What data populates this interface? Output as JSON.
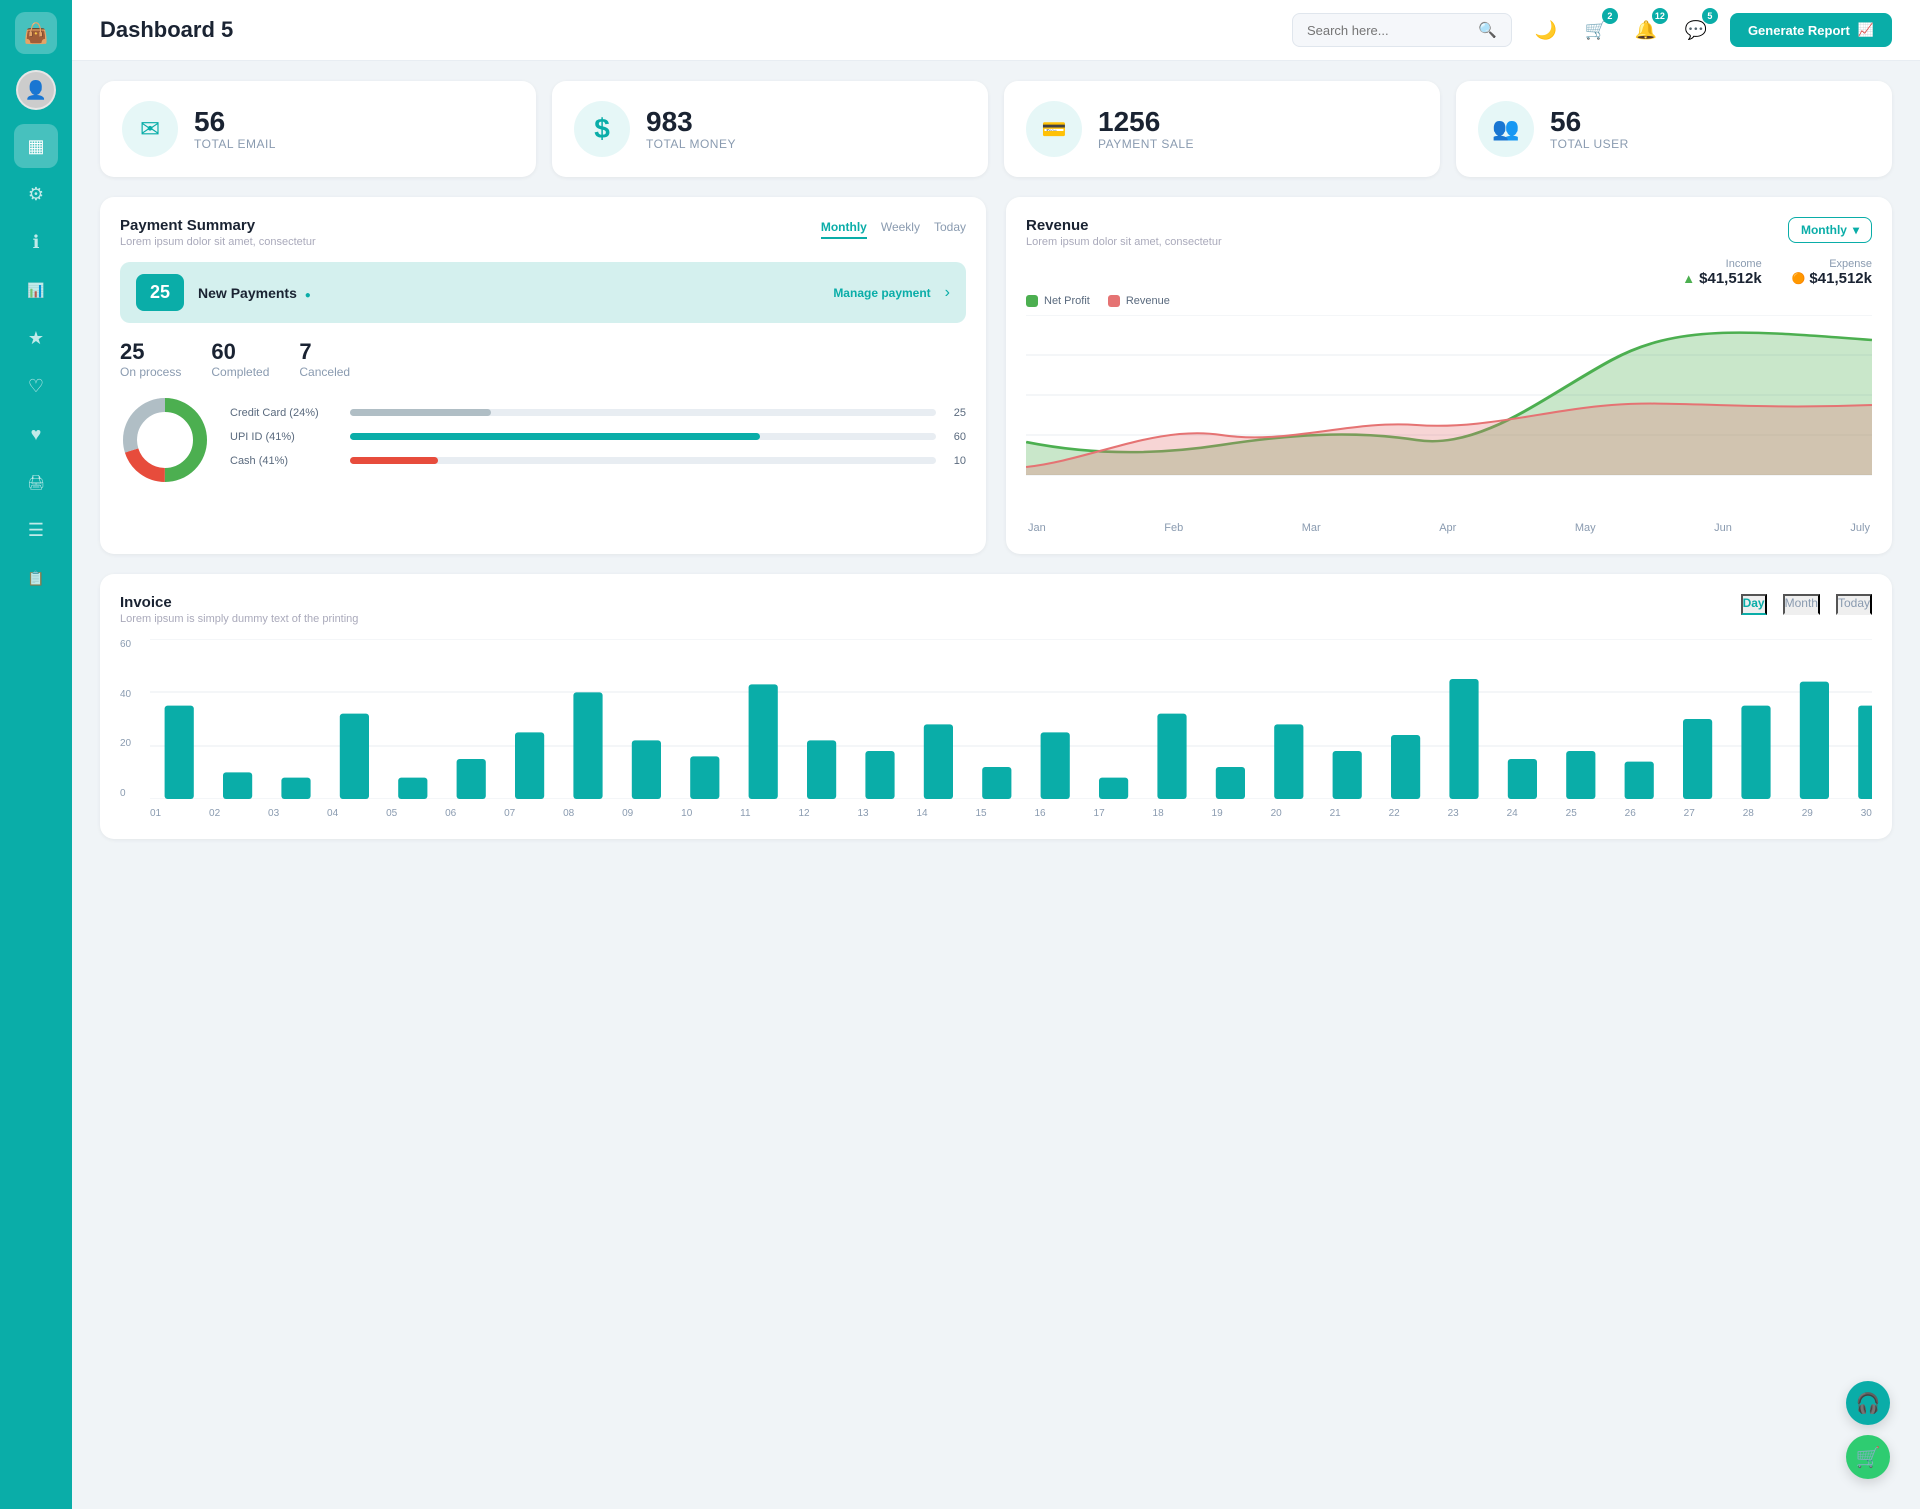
{
  "app": {
    "title": "Dashboard 5"
  },
  "header": {
    "search_placeholder": "Search here...",
    "generate_btn": "Generate Report",
    "badge_cart": "2",
    "badge_bell": "12",
    "badge_chat": "5"
  },
  "stat_cards": [
    {
      "id": "total-email",
      "number": "56",
      "label": "TOTAL EMAIL",
      "icon": "✉"
    },
    {
      "id": "total-money",
      "number": "983",
      "label": "TOTAL MONEY",
      "icon": "$"
    },
    {
      "id": "payment-sale",
      "number": "1256",
      "label": "PAYMENT SALE",
      "icon": "💳"
    },
    {
      "id": "total-user",
      "number": "56",
      "label": "TOTAL USER",
      "icon": "👥"
    }
  ],
  "payment_summary": {
    "title": "Payment Summary",
    "subtitle": "Lorem ipsum dolor sit amet, consectetur",
    "tabs": [
      "Monthly",
      "Weekly",
      "Today"
    ],
    "active_tab": "Monthly",
    "new_payments_count": "25",
    "new_payments_label": "New Payments",
    "manage_link": "Manage payment",
    "on_process": "25",
    "on_process_label": "On process",
    "completed": "60",
    "completed_label": "Completed",
    "canceled": "7",
    "canceled_label": "Canceled",
    "payment_methods": [
      {
        "label": "Credit Card (24%)",
        "percent": 24,
        "color": "#b0bec5",
        "value": "25"
      },
      {
        "label": "UPI ID (41%)",
        "percent": 70,
        "color": "#0aada8",
        "value": "60"
      },
      {
        "label": "Cash (41%)",
        "percent": 15,
        "color": "#e74c3c",
        "value": "10"
      }
    ]
  },
  "revenue": {
    "title": "Revenue",
    "subtitle": "Lorem ipsum dolor sit amet, consectetur",
    "dropdown": "Monthly",
    "income_label": "Income",
    "income_value": "$41,512k",
    "expense_label": "Expense",
    "expense_value": "$41,512k",
    "legend": [
      {
        "label": "Net Profit",
        "color": "#4caf50"
      },
      {
        "label": "Revenue",
        "color": "#e57373"
      }
    ],
    "x_labels": [
      "Jan",
      "Feb",
      "Mar",
      "Apr",
      "May",
      "Jun",
      "July"
    ],
    "net_profit": [
      28,
      25,
      30,
      28,
      45,
      90,
      88
    ],
    "revenue_data": [
      10,
      32,
      25,
      38,
      50,
      52,
      48
    ]
  },
  "invoice": {
    "title": "Invoice",
    "subtitle": "Lorem ipsum is simply dummy text of the printing",
    "tabs": [
      "Day",
      "Month",
      "Today"
    ],
    "active_tab": "Day",
    "x_labels": [
      "01",
      "02",
      "03",
      "04",
      "05",
      "06",
      "07",
      "08",
      "09",
      "10",
      "11",
      "12",
      "13",
      "14",
      "15",
      "16",
      "17",
      "18",
      "19",
      "20",
      "21",
      "22",
      "23",
      "24",
      "25",
      "26",
      "27",
      "28",
      "29",
      "30"
    ],
    "y_labels": [
      "0",
      "20",
      "40",
      "60"
    ],
    "bars": [
      35,
      10,
      8,
      32,
      8,
      15,
      25,
      40,
      22,
      16,
      43,
      22,
      18,
      28,
      12,
      25,
      8,
      32,
      12,
      28,
      18,
      24,
      45,
      15,
      18,
      14,
      30,
      35,
      44,
      35
    ]
  },
  "sidebar": {
    "items": [
      {
        "id": "dashboard",
        "icon": "▦",
        "active": true
      },
      {
        "id": "settings",
        "icon": "⚙"
      },
      {
        "id": "info",
        "icon": "ℹ"
      },
      {
        "id": "analytics",
        "icon": "📊"
      },
      {
        "id": "star",
        "icon": "★"
      },
      {
        "id": "heart-outline",
        "icon": "♡"
      },
      {
        "id": "heart-filled",
        "icon": "♥"
      },
      {
        "id": "print",
        "icon": "🖨"
      },
      {
        "id": "menu",
        "icon": "☰"
      },
      {
        "id": "list",
        "icon": "📋"
      }
    ]
  },
  "colors": {
    "teal": "#0aada8",
    "light_teal": "#e6f7f7",
    "red": "#e74c3c",
    "green": "#4caf50",
    "bar_color": "#0aada8"
  }
}
